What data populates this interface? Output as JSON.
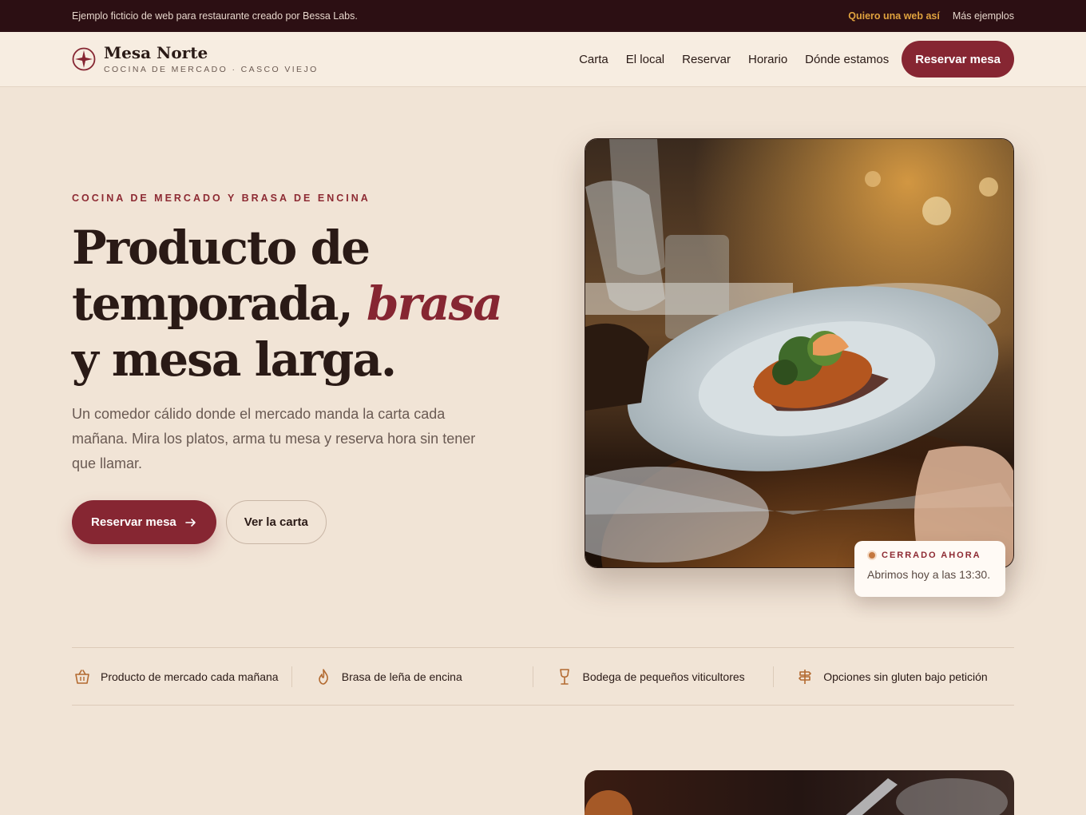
{
  "topbar": {
    "notice": "Ejemplo ficticio de web para restaurante creado por Bessa Labs.",
    "cta": "Quiero una web así",
    "more": "Más ejemplos"
  },
  "brand": {
    "name": "Mesa Norte",
    "tagline": "COCINA DE MERCADO · CASCO VIEJO"
  },
  "nav": {
    "links": [
      "Carta",
      "El local",
      "Reservar",
      "Horario",
      "Dónde estamos"
    ],
    "button": "Reservar mesa"
  },
  "hero": {
    "eyebrow": "COCINA DE MERCADO Y BRASA DE ENCINA",
    "headline_line1": "Producto de",
    "headline_line2_start": "temporada, ",
    "headline_accent": "brasa",
    "headline_line3": "y mesa larga.",
    "lede": "Un comedor cálido donde el mercado manda la carta cada mañana. Mira los platos, arma tu mesa y reserva hora sin tener que llamar.",
    "primary_button": "Reservar mesa",
    "secondary_button": "Ver la carta"
  },
  "status": {
    "label": "CERRADO AHORA",
    "text": "Abrimos hoy a las 13:30."
  },
  "features": [
    {
      "icon": "basket-icon",
      "label": "Producto de mercado cada mañana"
    },
    {
      "icon": "flame-icon",
      "label": "Brasa de leña de encina"
    },
    {
      "icon": "wine-glass-icon",
      "label": "Bodega de pequeños viticultores"
    },
    {
      "icon": "signpost-icon",
      "label": "Opciones sin gluten bajo petición"
    }
  ],
  "colors": {
    "accent": "#862632",
    "topbar_bg": "#2c0f13",
    "page_bg": "#f1e4d6",
    "highlight": "#e0a23e"
  }
}
